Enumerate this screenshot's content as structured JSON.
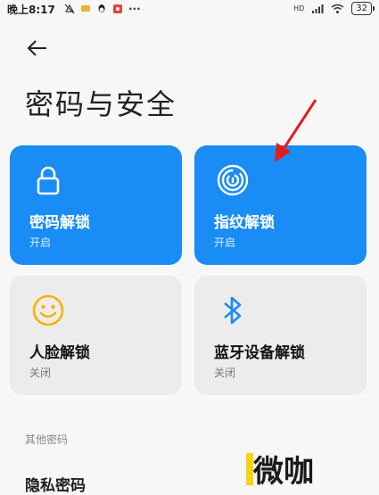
{
  "status_bar": {
    "time": "晚上8:17",
    "network": "HD",
    "battery": "32",
    "more": "···"
  },
  "header": {
    "title": "密码与安全"
  },
  "cards": [
    {
      "title": "密码解锁",
      "status": "开启",
      "icon": "lock-icon",
      "enabled": true
    },
    {
      "title": "指纹解锁",
      "status": "开启",
      "icon": "fingerprint-icon",
      "enabled": true
    },
    {
      "title": "人脸解锁",
      "status": "关闭",
      "icon": "face-icon",
      "enabled": false
    },
    {
      "title": "蓝牙设备解锁",
      "status": "关闭",
      "icon": "bluetooth-icon",
      "enabled": false
    }
  ],
  "other_section": {
    "label": "其他密码",
    "items": [
      {
        "label": "隐私密码"
      }
    ]
  },
  "watermark": {
    "text": "微咖"
  },
  "colors": {
    "card_on": "#1a8cf5",
    "card_off": "#ececec",
    "face_icon": "#f5b400",
    "bluetooth_icon": "#1a8cf5",
    "annotation_arrow": "#e01e1e"
  }
}
